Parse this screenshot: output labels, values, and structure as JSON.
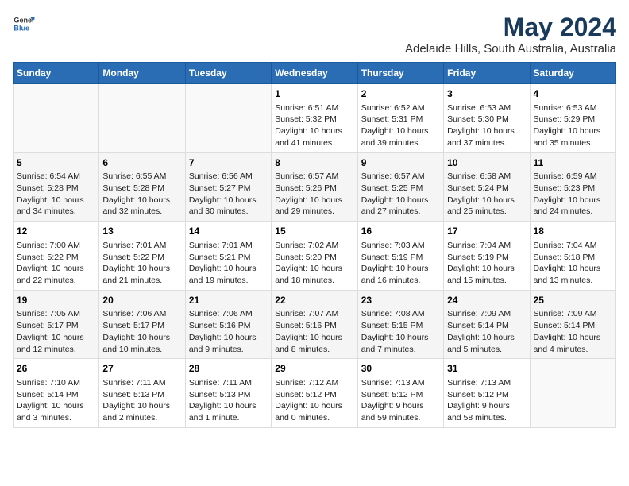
{
  "logo": {
    "general": "General",
    "blue": "Blue"
  },
  "title": "May 2024",
  "subtitle": "Adelaide Hills, South Australia, Australia",
  "days_header": [
    "Sunday",
    "Monday",
    "Tuesday",
    "Wednesday",
    "Thursday",
    "Friday",
    "Saturday"
  ],
  "weeks": [
    [
      {
        "day": "",
        "content": ""
      },
      {
        "day": "",
        "content": ""
      },
      {
        "day": "",
        "content": ""
      },
      {
        "day": "1",
        "content": "Sunrise: 6:51 AM\nSunset: 5:32 PM\nDaylight: 10 hours\nand 41 minutes."
      },
      {
        "day": "2",
        "content": "Sunrise: 6:52 AM\nSunset: 5:31 PM\nDaylight: 10 hours\nand 39 minutes."
      },
      {
        "day": "3",
        "content": "Sunrise: 6:53 AM\nSunset: 5:30 PM\nDaylight: 10 hours\nand 37 minutes."
      },
      {
        "day": "4",
        "content": "Sunrise: 6:53 AM\nSunset: 5:29 PM\nDaylight: 10 hours\nand 35 minutes."
      }
    ],
    [
      {
        "day": "5",
        "content": "Sunrise: 6:54 AM\nSunset: 5:28 PM\nDaylight: 10 hours\nand 34 minutes."
      },
      {
        "day": "6",
        "content": "Sunrise: 6:55 AM\nSunset: 5:28 PM\nDaylight: 10 hours\nand 32 minutes."
      },
      {
        "day": "7",
        "content": "Sunrise: 6:56 AM\nSunset: 5:27 PM\nDaylight: 10 hours\nand 30 minutes."
      },
      {
        "day": "8",
        "content": "Sunrise: 6:57 AM\nSunset: 5:26 PM\nDaylight: 10 hours\nand 29 minutes."
      },
      {
        "day": "9",
        "content": "Sunrise: 6:57 AM\nSunset: 5:25 PM\nDaylight: 10 hours\nand 27 minutes."
      },
      {
        "day": "10",
        "content": "Sunrise: 6:58 AM\nSunset: 5:24 PM\nDaylight: 10 hours\nand 25 minutes."
      },
      {
        "day": "11",
        "content": "Sunrise: 6:59 AM\nSunset: 5:23 PM\nDaylight: 10 hours\nand 24 minutes."
      }
    ],
    [
      {
        "day": "12",
        "content": "Sunrise: 7:00 AM\nSunset: 5:22 PM\nDaylight: 10 hours\nand 22 minutes."
      },
      {
        "day": "13",
        "content": "Sunrise: 7:01 AM\nSunset: 5:22 PM\nDaylight: 10 hours\nand 21 minutes."
      },
      {
        "day": "14",
        "content": "Sunrise: 7:01 AM\nSunset: 5:21 PM\nDaylight: 10 hours\nand 19 minutes."
      },
      {
        "day": "15",
        "content": "Sunrise: 7:02 AM\nSunset: 5:20 PM\nDaylight: 10 hours\nand 18 minutes."
      },
      {
        "day": "16",
        "content": "Sunrise: 7:03 AM\nSunset: 5:19 PM\nDaylight: 10 hours\nand 16 minutes."
      },
      {
        "day": "17",
        "content": "Sunrise: 7:04 AM\nSunset: 5:19 PM\nDaylight: 10 hours\nand 15 minutes."
      },
      {
        "day": "18",
        "content": "Sunrise: 7:04 AM\nSunset: 5:18 PM\nDaylight: 10 hours\nand 13 minutes."
      }
    ],
    [
      {
        "day": "19",
        "content": "Sunrise: 7:05 AM\nSunset: 5:17 PM\nDaylight: 10 hours\nand 12 minutes."
      },
      {
        "day": "20",
        "content": "Sunrise: 7:06 AM\nSunset: 5:17 PM\nDaylight: 10 hours\nand 10 minutes."
      },
      {
        "day": "21",
        "content": "Sunrise: 7:06 AM\nSunset: 5:16 PM\nDaylight: 10 hours\nand 9 minutes."
      },
      {
        "day": "22",
        "content": "Sunrise: 7:07 AM\nSunset: 5:16 PM\nDaylight: 10 hours\nand 8 minutes."
      },
      {
        "day": "23",
        "content": "Sunrise: 7:08 AM\nSunset: 5:15 PM\nDaylight: 10 hours\nand 7 minutes."
      },
      {
        "day": "24",
        "content": "Sunrise: 7:09 AM\nSunset: 5:14 PM\nDaylight: 10 hours\nand 5 minutes."
      },
      {
        "day": "25",
        "content": "Sunrise: 7:09 AM\nSunset: 5:14 PM\nDaylight: 10 hours\nand 4 minutes."
      }
    ],
    [
      {
        "day": "26",
        "content": "Sunrise: 7:10 AM\nSunset: 5:14 PM\nDaylight: 10 hours\nand 3 minutes."
      },
      {
        "day": "27",
        "content": "Sunrise: 7:11 AM\nSunset: 5:13 PM\nDaylight: 10 hours\nand 2 minutes."
      },
      {
        "day": "28",
        "content": "Sunrise: 7:11 AM\nSunset: 5:13 PM\nDaylight: 10 hours\nand 1 minute."
      },
      {
        "day": "29",
        "content": "Sunrise: 7:12 AM\nSunset: 5:12 PM\nDaylight: 10 hours\nand 0 minutes."
      },
      {
        "day": "30",
        "content": "Sunrise: 7:13 AM\nSunset: 5:12 PM\nDaylight: 9 hours\nand 59 minutes."
      },
      {
        "day": "31",
        "content": "Sunrise: 7:13 AM\nSunset: 5:12 PM\nDaylight: 9 hours\nand 58 minutes."
      },
      {
        "day": "",
        "content": ""
      }
    ]
  ]
}
